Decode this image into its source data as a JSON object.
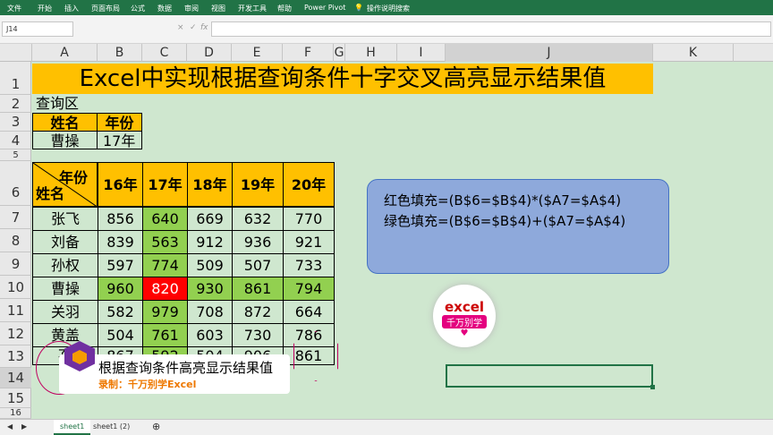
{
  "ribbon": {
    "tabs": [
      "文件",
      "开始",
      "插入",
      "页面布局",
      "公式",
      "数据",
      "审阅",
      "视图",
      "开发工具",
      "帮助",
      "Power Pivot",
      "操作说明搜索"
    ]
  },
  "formula_bar": {
    "name_box": "J14",
    "cancel": "×",
    "enter": "✓",
    "fx": "fx"
  },
  "columns": [
    "A",
    "B",
    "C",
    "D",
    "E",
    "F",
    "G",
    "H",
    "I",
    "J",
    "K"
  ],
  "rows": [
    "1",
    "2",
    "3",
    "4",
    "5",
    "6",
    "7",
    "8",
    "9",
    "10",
    "11",
    "12",
    "13",
    "14",
    "15",
    "16"
  ],
  "sheet": {
    "title": "Excel中实现根据查询条件十字交叉高亮显示结果值",
    "query_label": "查询区",
    "query_header": [
      "姓名",
      "年份"
    ],
    "query_values": [
      "曹操",
      "17年"
    ],
    "corner_top": "年份",
    "corner_bottom": "姓名",
    "years": [
      "16年",
      "17年",
      "18年",
      "19年",
      "20年"
    ],
    "names": [
      "张飞",
      "刘备",
      "孙权",
      "曹操",
      "关羽",
      "黄盖",
      "孔"
    ],
    "values": [
      [
        "856",
        "640",
        "669",
        "632",
        "770"
      ],
      [
        "839",
        "563",
        "912",
        "936",
        "921"
      ],
      [
        "597",
        "774",
        "509",
        "507",
        "733"
      ],
      [
        "960",
        "820",
        "930",
        "861",
        "794"
      ],
      [
        "582",
        "979",
        "708",
        "872",
        "664"
      ],
      [
        "504",
        "761",
        "603",
        "730",
        "786"
      ],
      [
        "867",
        "592",
        "504",
        "906",
        "861"
      ]
    ]
  },
  "note": {
    "line1": "红色填充=(B$6=$B$4)*($A7=$A$4)",
    "line2": "绿色填充=(B$6=$B$4)+($A7=$A$4)"
  },
  "logo": {
    "line1": "excel",
    "line2": "千万别学"
  },
  "banner": {
    "title": "根据查询条件高亮显示结果值",
    "subtitle": "录制：千万别学Excel"
  },
  "sheet_tabs": [
    "sheet1",
    "sheet1 (2)"
  ],
  "add_sheet": "⊕",
  "colors": {
    "green": "#92d050",
    "red": "#ff0000",
    "gold": "#ffc000",
    "note": "#8ea9db"
  }
}
